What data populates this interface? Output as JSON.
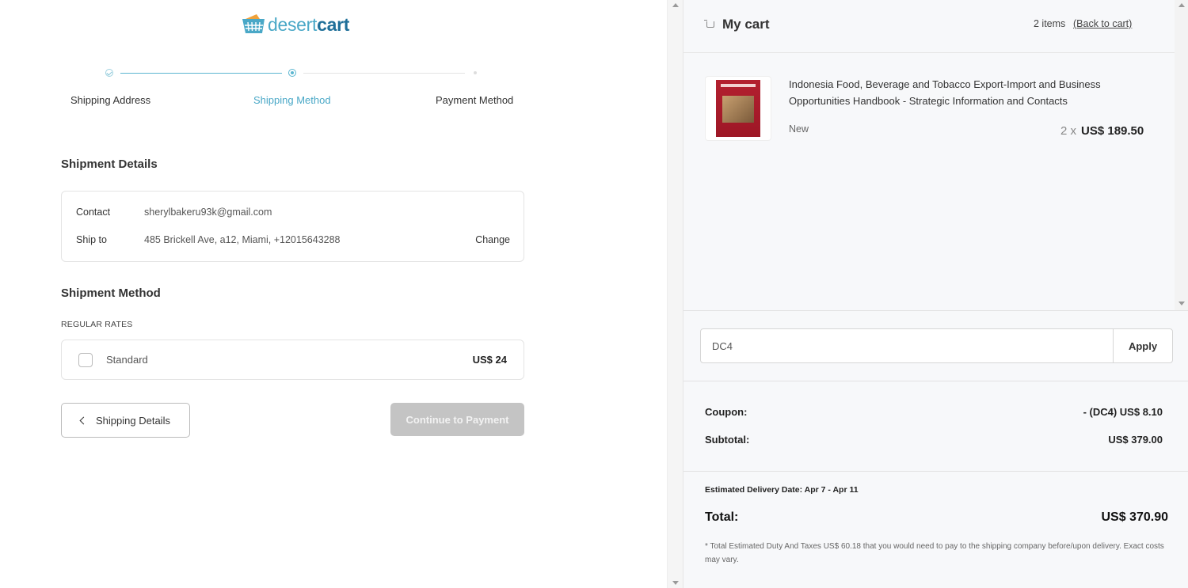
{
  "brand": {
    "name_part1": "desert",
    "name_part2": "cart",
    "color_light": "#4aa8c7",
    "color_dark": "#1f6f99"
  },
  "steps": [
    {
      "label": "Shipping Address",
      "state": "done"
    },
    {
      "label": "Shipping Method",
      "state": "active"
    },
    {
      "label": "Payment Method",
      "state": "todo"
    }
  ],
  "shipment_details": {
    "title": "Shipment Details",
    "contact_label": "Contact",
    "contact_value": "sherylbakeru93k@gmail.com",
    "shipto_label": "Ship to",
    "shipto_value": "485 Brickell Ave, a12, Miami, +12015643288",
    "change_label": "Change"
  },
  "shipment_method": {
    "title": "Shipment Method",
    "rates_label": "REGULAR RATES",
    "option_name": "Standard",
    "option_price": "US$ 24",
    "checked": false
  },
  "buttons": {
    "back_label": "Shipping Details",
    "continue_label": "Continue to Payment"
  },
  "cart": {
    "title": "My cart",
    "count": "2 items",
    "back_link": "(Back to cart)",
    "product": {
      "name": "Indonesia Food, Beverage and Tobacco Export-Import and Business Opportunities Handbook - Strategic Information and Contacts",
      "condition": "New",
      "qty": "2 x",
      "price": "US$ 189.50"
    },
    "coupon": {
      "value": "DC4",
      "apply_label": "Apply"
    },
    "coupon_row": {
      "label": "Coupon:",
      "value": "- (DC4) US$ 8.10"
    },
    "subtotal_row": {
      "label": "Subtotal:",
      "value": "US$ 379.00"
    },
    "delivery": "Estimated Delivery Date: Apr 7 - Apr 11",
    "total_row": {
      "label": "Total:",
      "value": "US$ 370.90"
    },
    "duty_note": "* Total Estimated Duty And Taxes US$ 60.18 that you would need to pay to the shipping company before/upon delivery. Exact costs may vary."
  },
  "icons": [
    "basket-logo-icon",
    "check-icon",
    "cart-icon",
    "chevron-left-icon",
    "scroll-up-icon",
    "scroll-down-icon"
  ]
}
